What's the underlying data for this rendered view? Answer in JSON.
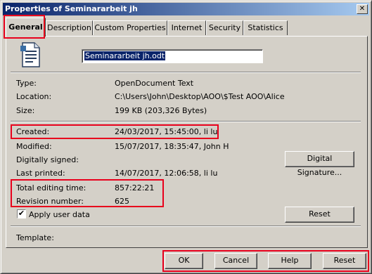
{
  "window": {
    "title": "Properties of Seminararbeit jh",
    "close_glyph": "✕"
  },
  "tabs": [
    "General",
    "Description",
    "Custom Properties",
    "Internet",
    "Security",
    "Statistics"
  ],
  "general": {
    "file_name": "Seminararbeit jh.odt",
    "icon": "opendocument-text-icon",
    "fields": [
      {
        "label": "Type:",
        "value": "OpenDocument Text"
      },
      {
        "label": "Location:",
        "value": "C:\\Users\\John\\Desktop\\AOO\\$Test AOO\\Alice"
      },
      {
        "label": "Size:",
        "value": "199 KB (203,326 Bytes)"
      },
      {
        "label": "Created:",
        "value": "24/03/2017, 15:45:00, li lu"
      },
      {
        "label": "Modified:",
        "value": "15/07/2017, 18:35:47, John H"
      },
      {
        "label": "Digitally signed:",
        "value": ""
      },
      {
        "label": "Last printed:",
        "value": "14/07/2017, 12:06:58, li lu"
      },
      {
        "label": "Total editing time:",
        "value": "857:22:21"
      },
      {
        "label": "Revision number:",
        "value": "625"
      }
    ],
    "digital_signature_button": "Digital Signature...",
    "apply_user_data_label": "Apply user data",
    "apply_user_data_checked": true,
    "checkmark": "✔",
    "reset_button": "Reset",
    "template_label": "Template:"
  },
  "footer": {
    "ok": "OK",
    "cancel": "Cancel",
    "help": "Help",
    "reset": "Reset"
  },
  "colors": {
    "highlight": "#e8001c",
    "titlebar_start": "#0a246a",
    "dialog_bg": "#d4d0c8"
  }
}
